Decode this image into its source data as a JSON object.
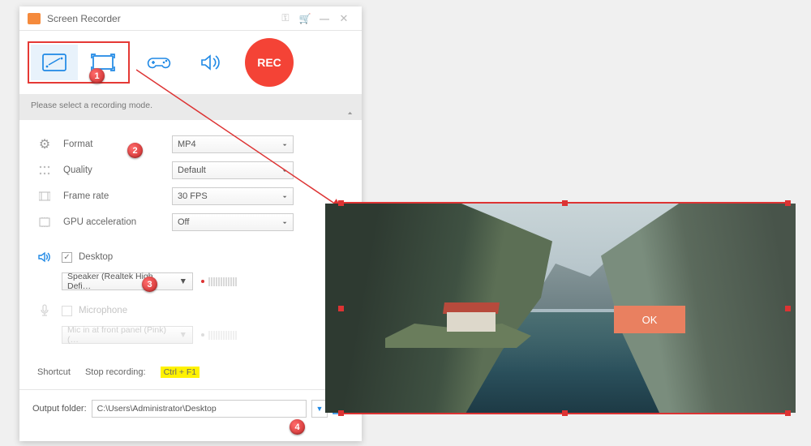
{
  "title": "Screen Recorder",
  "rec_label": "REC",
  "hint": "Please select a recording mode.",
  "settings": {
    "format_label": "Format",
    "format_value": "MP4",
    "quality_label": "Quality",
    "quality_value": "Default",
    "framerate_label": "Frame rate",
    "framerate_value": "30 FPS",
    "gpu_label": "GPU acceleration",
    "gpu_value": "Off"
  },
  "audio": {
    "desktop_label": "Desktop",
    "desktop_device": "Speaker (Realtek High Defi…",
    "mic_label": "Microphone",
    "mic_device": "Mic in at front panel (Pink) (…"
  },
  "shortcut": {
    "label": "Shortcut",
    "stop_label": "Stop recording:",
    "stop_key": "Ctrl + F1"
  },
  "output": {
    "label": "Output folder:",
    "path": "C:\\Users\\Administrator\\Desktop"
  },
  "ok_button": "OK",
  "callouts": {
    "c1": "1",
    "c2": "2",
    "c3": "3",
    "c4": "4"
  }
}
